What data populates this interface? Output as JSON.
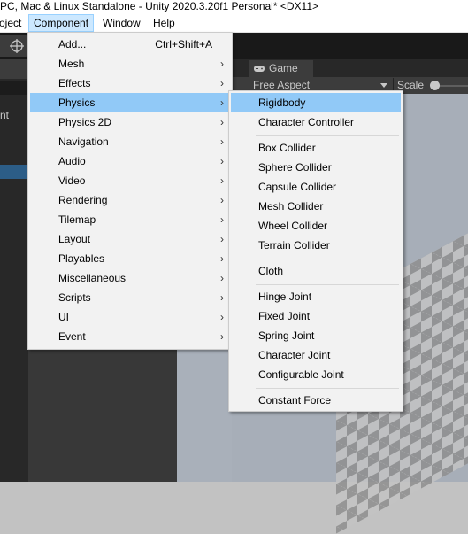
{
  "window": {
    "title": "PC, Mac & Linux Standalone - Unity 2020.3.20f1 Personal* <DX11>"
  },
  "menubar": {
    "items": [
      "oject",
      "Component",
      "Window",
      "Help"
    ]
  },
  "hierarchy": {
    "partial_text": "nt"
  },
  "component_menu": {
    "items": [
      {
        "label": "Add...",
        "shortcut": "Ctrl+Shift+A"
      },
      {
        "label": "Mesh",
        "arrow": "›"
      },
      {
        "label": "Effects",
        "arrow": "›"
      },
      {
        "label": "Physics",
        "arrow": "›"
      },
      {
        "label": "Physics 2D",
        "arrow": "›"
      },
      {
        "label": "Navigation",
        "arrow": "›"
      },
      {
        "label": "Audio",
        "arrow": "›"
      },
      {
        "label": "Video",
        "arrow": "›"
      },
      {
        "label": "Rendering",
        "arrow": "›"
      },
      {
        "label": "Tilemap",
        "arrow": "›"
      },
      {
        "label": "Layout",
        "arrow": "›"
      },
      {
        "label": "Playables",
        "arrow": "›"
      },
      {
        "label": "Miscellaneous",
        "arrow": "›"
      },
      {
        "label": "Scripts",
        "arrow": "›"
      },
      {
        "label": "UI",
        "arrow": "›"
      },
      {
        "label": "Event",
        "arrow": "›"
      }
    ]
  },
  "physics_menu": {
    "items": [
      {
        "label": "Rigidbody"
      },
      {
        "label": "Character Controller"
      },
      {
        "label": "Box Collider"
      },
      {
        "label": "Sphere Collider"
      },
      {
        "label": "Capsule Collider"
      },
      {
        "label": "Mesh Collider"
      },
      {
        "label": "Wheel Collider"
      },
      {
        "label": "Terrain Collider"
      },
      {
        "label": "Cloth"
      },
      {
        "label": "Hinge Joint"
      },
      {
        "label": "Fixed Joint"
      },
      {
        "label": "Spring Joint"
      },
      {
        "label": "Character Joint"
      },
      {
        "label": "Configurable Joint"
      },
      {
        "label": "Constant Force"
      }
    ]
  },
  "game_view": {
    "tab_label": "Game",
    "tab_icon": "gamepad-icon",
    "aspect": "Free Aspect",
    "scale_label": "Scale"
  },
  "colors": {
    "highlight": "#91c9f7",
    "menu_bg": "#f2f2f2",
    "menubar_active": "#cce8ff",
    "editor_dark": "#383838"
  }
}
